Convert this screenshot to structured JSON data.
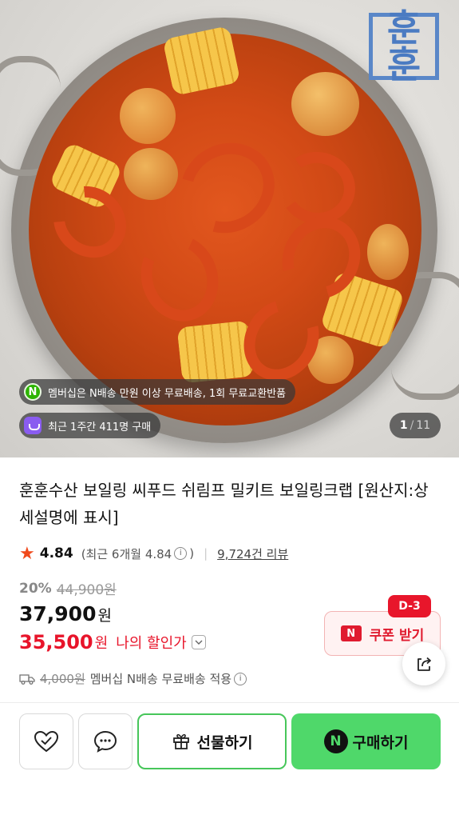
{
  "hero": {
    "logo_text": "훈훈",
    "badge_membership": "멤버십은 N배송 만원 이상 무료배송, 1회 무료교환반품",
    "badge_membership_icon": "naver-n-icon",
    "badge_recent": "최근 1주간 411명 구매",
    "badge_recent_icon": "shopping-bag-icon",
    "pager_current": "1",
    "pager_separator": "/",
    "pager_total": "11"
  },
  "product": {
    "title": "훈훈수산 보일링 씨푸드 쉬림프 밀키트 보일링크랩 [원산지:상세설명에 표시]",
    "rating": "4.84",
    "rating_recent": "(최근 6개월 4.84",
    "rating_recent_close": ")",
    "reviews": "9,724건 리뷰"
  },
  "pricing": {
    "discount_pct": "20%",
    "original_price": "44,900원",
    "price": "37,900",
    "price_unit": "원",
    "my_price": "35,500",
    "my_price_unit": "원",
    "my_price_label": "나의 할인가",
    "coupon_label": "쿠폰 받기",
    "coupon_icon_text": "N",
    "coupon_dday": "D-3",
    "shipping_old": "4,000원",
    "shipping_text": "멤버십 N배송 무료배송 적용"
  },
  "actions": {
    "gift_label": "선물하기",
    "buy_label": "구매하기",
    "buy_icon_text": "N"
  },
  "colors": {
    "accent_green": "#4fd86a",
    "discount_red": "#e8142a",
    "star_orange": "#f04a1c"
  }
}
